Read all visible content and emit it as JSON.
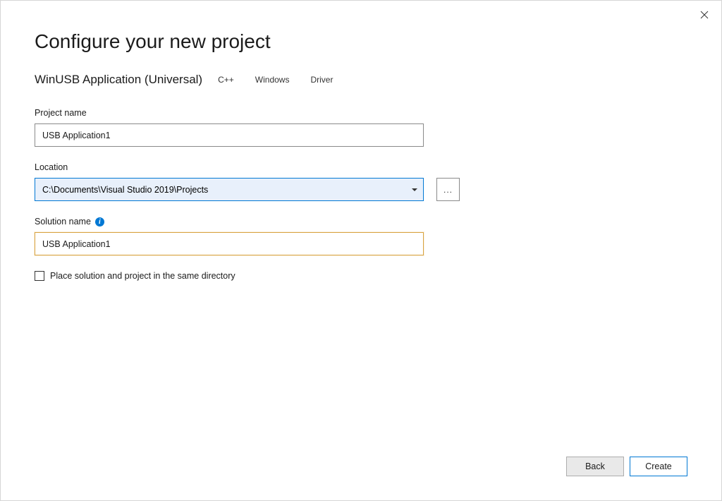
{
  "title": "Configure your new project",
  "close_label": "Close",
  "template": {
    "name": "WinUSB Application (Universal)",
    "tags": [
      "C++",
      "Windows",
      "Driver"
    ]
  },
  "fields": {
    "project_name": {
      "label": "Project name",
      "value": "USB Application1"
    },
    "location": {
      "label": "Location",
      "value": "C:\\Documents\\Visual Studio 2019\\Projects",
      "browse_label": "..."
    },
    "solution_name": {
      "label": "Solution name",
      "info_tooltip": "i",
      "value": "USB Application1"
    },
    "same_directory": {
      "label": "Place solution and project in the same directory",
      "checked": false
    }
  },
  "buttons": {
    "back": "Back",
    "create": "Create"
  }
}
